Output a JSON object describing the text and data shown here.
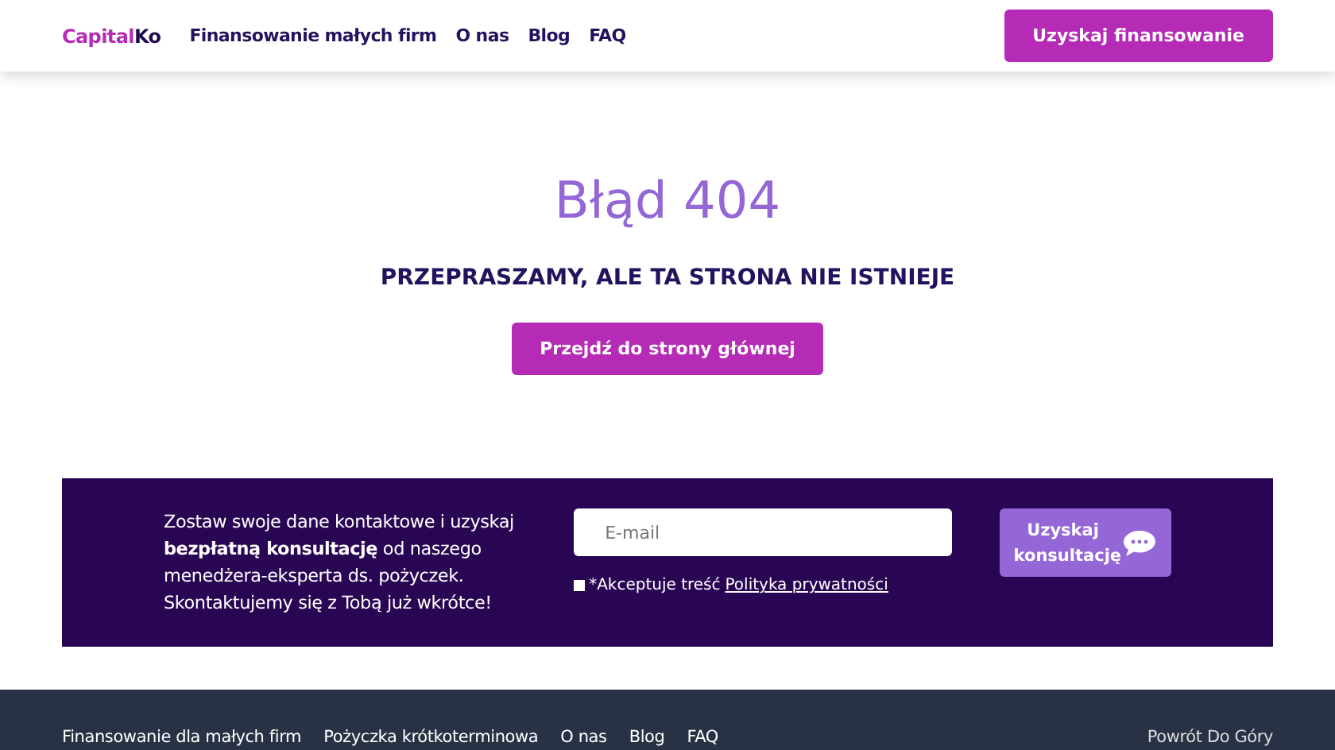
{
  "header": {
    "logo": {
      "highlight": "Capital",
      "rest": "Ko"
    },
    "nav": [
      {
        "label": "Finansowanie małych firm"
      },
      {
        "label": "O nas"
      },
      {
        "label": "Blog"
      },
      {
        "label": "FAQ"
      }
    ],
    "cta": "Uzyskaj finansowanie"
  },
  "error": {
    "title": "Błąd 404",
    "message": "PRZEPRASZAMY, ALE TA STRONA NIE ISTNIEJE",
    "button": "Przejdź do strony głównej"
  },
  "consultation": {
    "text": "Zostaw swoje dane kontaktowe i uzyskaj **bezpłatną konsultację** od naszego menedżera-eksperta ds. pożyczek. Skontaktujemy się z Tobą już wkrótce!",
    "email": {
      "placeholder": "E-mail"
    },
    "consent": {
      "checked": false,
      "text": "*Akceptuje treść",
      "link": "Polityka prywatności"
    },
    "button": "Uzyskaj konsultację"
  },
  "footer": {
    "links": [
      {
        "label": "Finansowanie dla małych firm"
      },
      {
        "label": "Pożyczka krótkoterminowa"
      },
      {
        "label": "O nas"
      },
      {
        "label": "Blog"
      },
      {
        "label": "FAQ"
      }
    ],
    "back_to_top": "Powrót Do Góry"
  }
}
